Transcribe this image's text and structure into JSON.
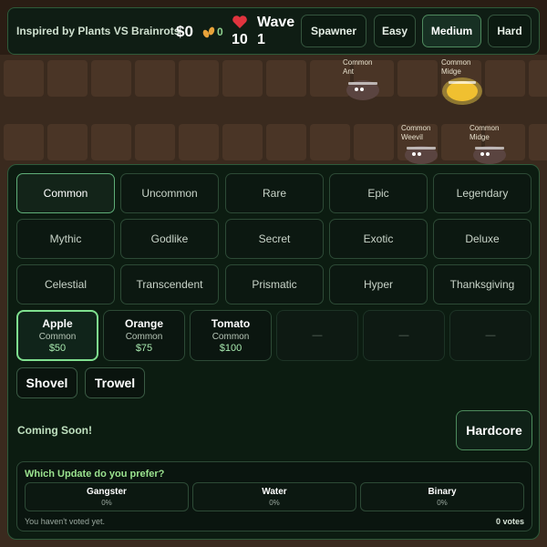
{
  "header": {
    "title": "Inspired by Plants VS Brainrots",
    "money": "$0",
    "seeds": "0",
    "lives": "10",
    "wave_label": "Wave",
    "wave_number": "1",
    "buttons": [
      "Spawner",
      "Easy",
      "Medium",
      "Hard"
    ],
    "active_difficulty": "Medium"
  },
  "enemies": [
    {
      "rarity": "Common",
      "name": "Ant",
      "color": "#5a4440"
    },
    {
      "rarity": "Common",
      "name": "Midge",
      "color": "#f0c030"
    },
    {
      "rarity": "Common",
      "name": "Weevil",
      "color": "#5a4440"
    },
    {
      "rarity": "Common",
      "name": "Midge",
      "color": "#5a4440"
    }
  ],
  "rarities": [
    "Common",
    "Uncommon",
    "Rare",
    "Epic",
    "Legendary",
    "Mythic",
    "Godlike",
    "Secret",
    "Exotic",
    "Deluxe",
    "Celestial",
    "Transcendent",
    "Prismatic",
    "Hyper",
    "Thanksgiving"
  ],
  "selected_rarity": "Common",
  "plants": [
    {
      "name": "Apple",
      "rarity": "Common",
      "price": "$50"
    },
    {
      "name": "Orange",
      "rarity": "Common",
      "price": "$75"
    },
    {
      "name": "Tomato",
      "rarity": "Common",
      "price": "$100"
    }
  ],
  "empty_slot_label": "—",
  "tools": [
    "Shovel",
    "Trowel"
  ],
  "coming_soon": "Coming Soon!",
  "hardcore_label": "Hardcore",
  "poll": {
    "question": "Which Update do you prefer?",
    "options": [
      {
        "name": "Gangster",
        "percent": "0%"
      },
      {
        "name": "Water",
        "percent": "0%"
      },
      {
        "name": "Binary",
        "percent": "0%"
      }
    ],
    "note": "You haven't voted yet.",
    "votes": "0 votes"
  },
  "colors": {
    "accent": "#7fe08f",
    "panel": "#0a1b11",
    "soil": "#3a2a1e",
    "heart": "#e0343e",
    "seed": "#e8a33a"
  },
  "icons": [
    "seed-icon",
    "heart-icon"
  ]
}
